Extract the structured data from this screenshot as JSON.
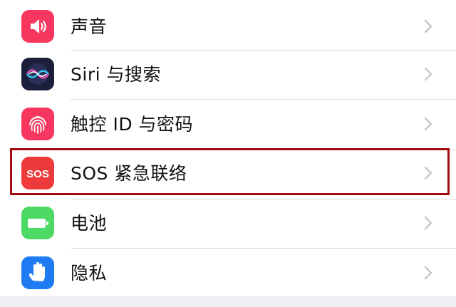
{
  "settings": {
    "items": [
      {
        "label": "声音",
        "icon": "speaker-icon",
        "icon_color": "#f7375f"
      },
      {
        "label": "Siri 与搜索",
        "icon": "siri-icon",
        "icon_color": "#1b1f3a"
      },
      {
        "label": "触控 ID 与密码",
        "icon": "fingerprint-icon",
        "icon_color": "#f7375f"
      },
      {
        "label": "SOS 紧急联络",
        "icon": "sos-icon",
        "icon_color": "#ee3a3a",
        "icon_text": "SOS",
        "highlighted": true
      },
      {
        "label": "电池",
        "icon": "battery-icon",
        "icon_color": "#4cd964"
      },
      {
        "label": "隐私",
        "icon": "hand-icon",
        "icon_color": "#1f7bf2"
      }
    ]
  },
  "colors": {
    "background": "#efeff4",
    "highlight_border": "#a30a10",
    "chevron": "#c7c7cc"
  }
}
